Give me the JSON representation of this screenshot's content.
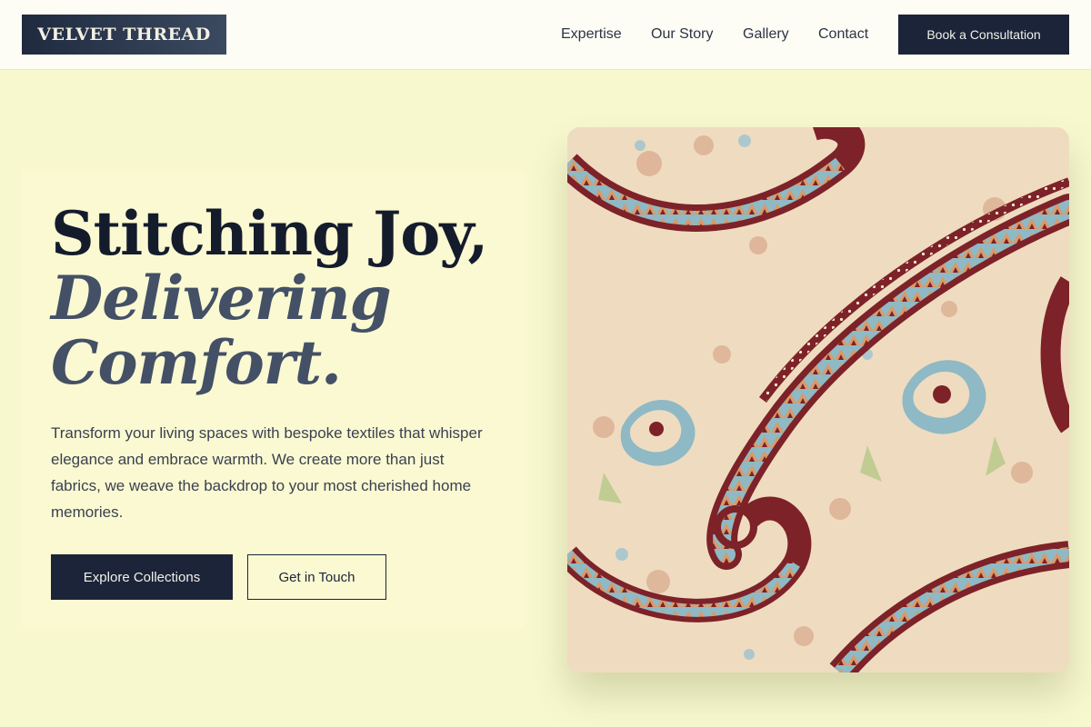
{
  "brand": {
    "name": "VELVET THREAD"
  },
  "nav": {
    "links": [
      "Expertise",
      "Our Story",
      "Gallery",
      "Contact"
    ],
    "cta_label": "Book a Consultation"
  },
  "hero": {
    "headline_line1": "Stitching Joy,",
    "headline_line2": "Delivering",
    "headline_line3": "Comfort.",
    "description": "Transform your living spaces with bespoke textiles that whisper elegance and embrace warmth. We create more than just fabrics, we weave the backdrop to your most cherished home memories.",
    "primary_button": "Explore Collections",
    "secondary_button": "Get in Touch"
  },
  "colors": {
    "page_background": "#f8f8cf",
    "navy": "#1b2438",
    "paisley_red": "#7d2228",
    "paisley_blue": "#8fb9c4",
    "paisley_cream": "#f0dcc0"
  },
  "icons": {
    "hero_image": "paisley-fabric-image"
  }
}
